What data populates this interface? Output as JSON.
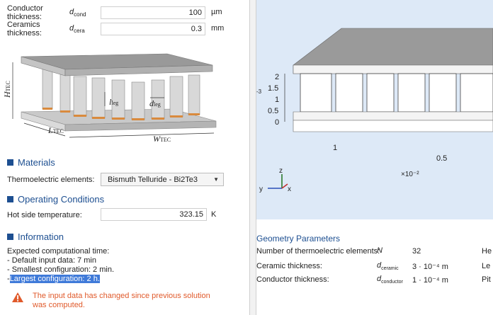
{
  "params": {
    "conductor": {
      "label": "Conductor thickness:",
      "sym": "d",
      "sub": "cond",
      "value": "100",
      "unit": "µm"
    },
    "ceramics": {
      "label": "Ceramics thickness:",
      "sym": "d",
      "sub": "cera",
      "value": "0.3",
      "unit": "mm"
    }
  },
  "diagram": {
    "h_label": "H",
    "h_sub": "TEC",
    "l_label": "L",
    "l_sub": "TEC",
    "w_label": "W",
    "w_sub": "TEC",
    "leg_label": "l",
    "leg_sub": "leg",
    "dleg_label": "d",
    "dleg_sub": "leg"
  },
  "materials": {
    "title": "Materials",
    "label": "Thermoelectric elements:",
    "selected": "Bismuth Telluride - Bi2Te3"
  },
  "operating": {
    "title": "Operating Conditions",
    "label": "Hot side temperature:",
    "value": "323.15",
    "unit": "K"
  },
  "information": {
    "title": "Information",
    "line1": "Expected computational time:",
    "line2": " - Default input data: 7 min",
    "line3": " - Smallest configuration: 2 min.",
    "line4_prefix": " -",
    "line4_selected": "Largest configuration: 2 h."
  },
  "warning": {
    "text": "The input data has changed since previous solution was computed."
  },
  "plot": {
    "y_ticks": [
      "2",
      "1.5",
      "1",
      "0.5",
      "0"
    ],
    "y_partial": "-3",
    "x_ticks": [
      "1",
      "0.5"
    ],
    "x_scale": "×10⁻²",
    "triad": {
      "x": "x",
      "y": "y",
      "z": "z"
    }
  },
  "geometry": {
    "title": "Geometry Parameters",
    "rows": [
      {
        "label": "Number of thermoelectric elements:",
        "sym": "N",
        "sub": "",
        "value": "32",
        "next": "He"
      },
      {
        "label": "Ceramic thickness:",
        "sym": "d",
        "sub": "ceramic",
        "value": "3 · 10⁻⁴ m",
        "next": "Le"
      },
      {
        "label": "Conductor thickness:",
        "sym": "d",
        "sub": "conductor",
        "value": "1 · 10⁻⁴ m",
        "next": "Pit"
      }
    ]
  },
  "colors": {
    "accent": "#1d4f91",
    "warning": "#e05a2b",
    "plot_bg": "#dde9f7",
    "solder": "#d98a3d"
  }
}
